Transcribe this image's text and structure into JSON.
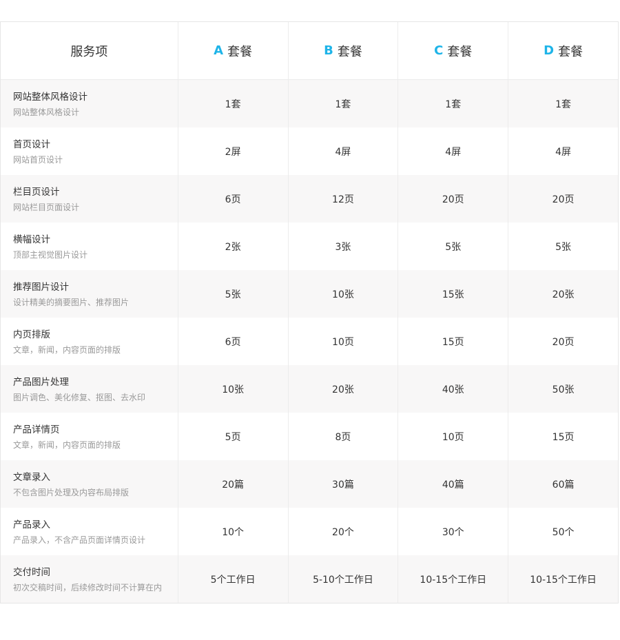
{
  "header": {
    "service_label": "服务项",
    "packages": [
      {
        "letter": "A",
        "label": "套餐"
      },
      {
        "letter": "B",
        "label": "套餐"
      },
      {
        "letter": "C",
        "label": "套餐"
      },
      {
        "letter": "D",
        "label": "套餐"
      }
    ]
  },
  "rows": [
    {
      "title": "网站整体风格设计",
      "desc": "网站整体风格设计",
      "values": [
        "1套",
        "1套",
        "1套",
        "1套"
      ]
    },
    {
      "title": "首页设计",
      "desc": "网站首页设计",
      "values": [
        "2屏",
        "4屏",
        "4屏",
        "4屏"
      ]
    },
    {
      "title": "栏目页设计",
      "desc": "网站栏目页面设计",
      "values": [
        "6页",
        "12页",
        "20页",
        "20页"
      ]
    },
    {
      "title": "横幅设计",
      "desc": "顶部主视觉图片设计",
      "values": [
        "2张",
        "3张",
        "5张",
        "5张"
      ]
    },
    {
      "title": "推荐图片设计",
      "desc": "设计精美的摘要图片、推荐图片",
      "values": [
        "5张",
        "10张",
        "15张",
        "20张"
      ]
    },
    {
      "title": "内页排版",
      "desc": "文章，新闻，内容页面的排版",
      "values": [
        "6页",
        "10页",
        "15页",
        "20页"
      ]
    },
    {
      "title": "产品图片处理",
      "desc": "图片调色、美化修复、抠图、去水印",
      "values": [
        "10张",
        "20张",
        "40张",
        "50张"
      ]
    },
    {
      "title": "产品详情页",
      "desc": "文章，新闻，内容页面的排版",
      "values": [
        "5页",
        "8页",
        "10页",
        "15页"
      ]
    },
    {
      "title": "文章录入",
      "desc": "不包含图片处理及内容布局排版",
      "values": [
        "20篇",
        "30篇",
        "40篇",
        "60篇"
      ]
    },
    {
      "title": "产品录入",
      "desc": "产品录入，不含产品页面详情页设计",
      "values": [
        "10个",
        "20个",
        "30个",
        "50个"
      ]
    },
    {
      "title": "交付时间",
      "desc": "初次交稿时间，后续修改时间不计算在内",
      "values": [
        "5个工作日",
        "5-10个工作日",
        "10-15个工作日",
        "10-15个工作日"
      ]
    }
  ],
  "colors": {
    "accent": "#1eb4e8",
    "stripe": "#f8f7f7",
    "border": "#ececec",
    "muted": "#999999"
  }
}
